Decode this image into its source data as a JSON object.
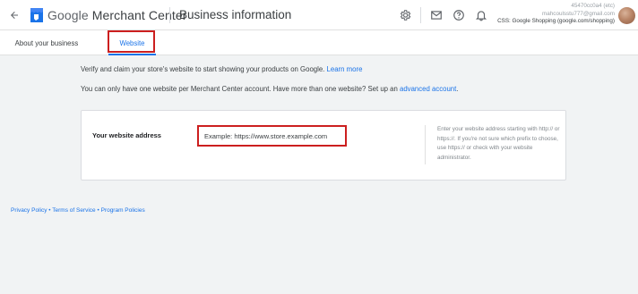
{
  "header": {
    "brand_google": "Google",
    "brand_product": "Merchant Center",
    "page_title": "Business information",
    "icons": [
      "back-arrow-icon",
      "merchant-center-logo-icon",
      "settings-icon",
      "mail-icon",
      "help-icon",
      "notifications-icon"
    ],
    "account": {
      "id": "45470cc0a4 (etc)",
      "email": "mahcoulsstu777@gmail.com",
      "name": "CSS: Google Shopping (google.com/shopping)"
    }
  },
  "tabs": [
    {
      "label": "About your business",
      "active": false
    },
    {
      "label": "Website",
      "active": true
    }
  ],
  "main": {
    "info_line1": "Verify and claim your store's website to start showing your products on Google.",
    "learn_more": "Learn more",
    "info_line2": "You can only have one website per Merchant Center account. Have more than one website? Set up an",
    "advanced_account": "advanced account",
    "info_line2_end": ".",
    "card": {
      "label": "Your website address",
      "input_placeholder": "Example: https://www.store.example.com",
      "input_value": "",
      "help_text": "Enter your website address starting with http:// or https://. If you're not sure which prefix to choose, use https:// or check with your website administrator."
    }
  },
  "footer": {
    "privacy": "Privacy Policy",
    "terms": "Terms of Service",
    "program": "Program Policies",
    "separator": "•"
  },
  "colors": {
    "accent": "#1a73e8",
    "highlight": "#cc1f1f",
    "background": "#f1f3f4"
  }
}
